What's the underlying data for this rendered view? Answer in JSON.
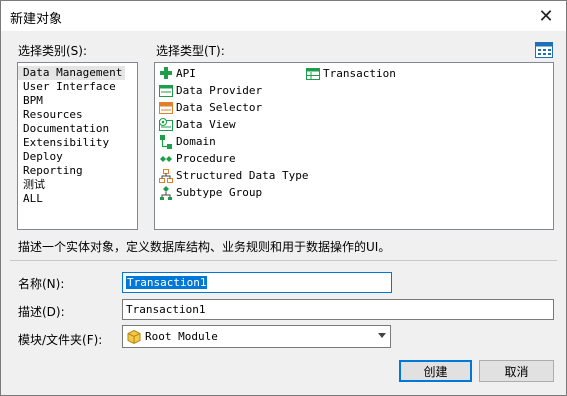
{
  "window": {
    "title": "新建对象",
    "close_glyph": "✕"
  },
  "categories": {
    "label": "选择类别(S):",
    "items": [
      "Data Management",
      "User Interface",
      "BPM",
      "Resources",
      "Documentation",
      "Extensibility",
      "Deploy",
      "Reporting",
      "测试",
      "ALL"
    ],
    "selected": "Data Management"
  },
  "types": {
    "label": "选择类型(T):",
    "items": [
      {
        "label": "API",
        "icon": "api-icon"
      },
      {
        "label": "Data Provider",
        "icon": "data-provider-icon"
      },
      {
        "label": "Data Selector",
        "icon": "data-selector-icon"
      },
      {
        "label": "Data View",
        "icon": "data-view-icon"
      },
      {
        "label": "Domain",
        "icon": "domain-icon"
      },
      {
        "label": "Procedure",
        "icon": "procedure-icon"
      },
      {
        "label": "Structured Data Type",
        "icon": "structured-data-type-icon"
      },
      {
        "label": "Subtype Group",
        "icon": "subtype-group-icon"
      },
      {
        "label": "Transaction",
        "icon": "transaction-icon"
      }
    ],
    "selected": "Transaction"
  },
  "description": "描述一个实体对象，定义数据库结构、业务规则和用于数据操作的UI。",
  "form": {
    "name_label": "名称(N):",
    "name_value": "Transaction1",
    "desc_label": "描述(D):",
    "desc_value": "Transaction1",
    "module_label": "模块/文件夹(F):",
    "module_value": "Root Module"
  },
  "buttons": {
    "create": "创建",
    "cancel": "取消"
  },
  "colors": {
    "selection": "#0078d7",
    "accent_green": "#1e9e4a",
    "accent_orange": "#e0802a"
  }
}
